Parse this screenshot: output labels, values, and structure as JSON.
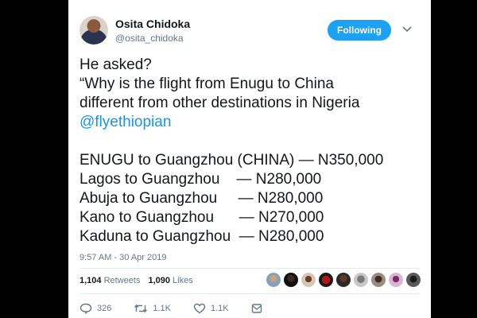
{
  "tweet": {
    "author_name": "Osita Chidoka",
    "author_handle": "@osita_chidoka",
    "follow_label": "Following",
    "lines": {
      "l1": "He asked?",
      "l2": "“Why is the flight from Enugu to China",
      "l3": "different from other destinations in Nigeria",
      "mention": "@flyethiopian",
      "r1": "ENUGU to Guangzhou (CHINA) — N350,000",
      "r2": "Lagos to Guangzhou    — N280,000",
      "r3": "Abuja to Guangzhou     — N280,000",
      "r4": "Kano to Guangzhou      — N270,000",
      "r5": "Kaduna to Guangzhou  — N280,000"
    },
    "timestamp": "9:57 AM - 30 Apr 2019"
  },
  "stats": {
    "retweets_count": "1,104",
    "retweets_label": "Retweets",
    "likes_count": "1,090",
    "likes_label": "Likes"
  },
  "actions": {
    "reply_count": "326",
    "retweet_count": "1.1K",
    "like_count": "1.1K"
  },
  "colors": {
    "accent": "#1da1f2",
    "link": "#1b95e0",
    "muted": "#657786",
    "text": "#14171a"
  },
  "icons": [
    "chevron-down-icon",
    "reply-icon",
    "retweet-icon",
    "like-icon",
    "message-icon"
  ]
}
